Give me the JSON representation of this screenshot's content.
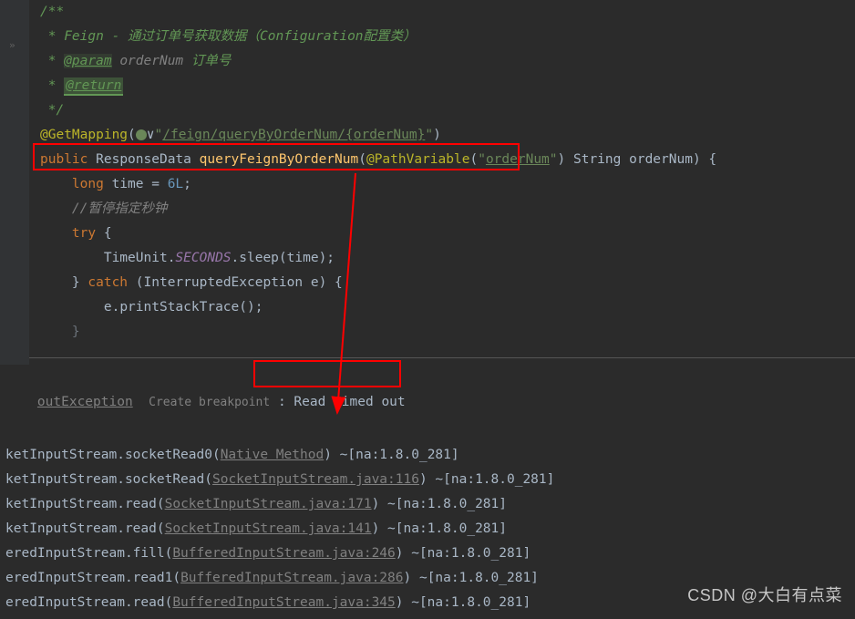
{
  "code": {
    "doc_line1": "/**",
    "doc_line2_prefix": " * ",
    "doc_line2_text": "Feign - 通过订单号获取数据（Configuration配置类）",
    "doc_line3_prefix": " * ",
    "doc_param_tag": "@param",
    "doc_param_name": " orderNum ",
    "doc_param_desc": "订单号",
    "doc_line4_prefix": " * ",
    "doc_return_tag": "@return",
    "doc_line5": " */",
    "annotation": "@GetMapping",
    "mapping_path": "/feign/queryByOrderNum/{orderNum}",
    "kw_public": "public",
    "return_type": "ResponseData",
    "method_name": "queryFeignByOrderNum",
    "path_var_anno": "@PathVariable",
    "path_var_value": "orderNum",
    "param_type": "String",
    "param_name": "orderNum",
    "kw_long": "long",
    "var_time": "time",
    "literal": "6L",
    "comment_pause": "//暂停指定秒钟",
    "kw_try": "try",
    "timeunit": "TimeUnit",
    "seconds": "SECONDS",
    "sleep": "sleep",
    "sleep_arg": "time",
    "kw_catch": "catch",
    "exception_type": "InterruptedException",
    "exception_var": "e",
    "print_stack": "printStackTrace"
  },
  "console": {
    "exception_text": "outException",
    "breakpoint_hint": "Create breakpoint",
    "error_message": "Read timed out",
    "stack": [
      {
        "prefix": "ketInputStream.socketRead0(",
        "link": "Native Method",
        "suffix": ") ~[na:1.8.0_281]"
      },
      {
        "prefix": "ketInputStream.socketRead(",
        "link": "SocketInputStream.java:116",
        "suffix": ") ~[na:1.8.0_281]"
      },
      {
        "prefix": "ketInputStream.read(",
        "link": "SocketInputStream.java:171",
        "suffix": ") ~[na:1.8.0_281]"
      },
      {
        "prefix": "ketInputStream.read(",
        "link": "SocketInputStream.java:141",
        "suffix": ") ~[na:1.8.0_281]"
      },
      {
        "prefix": "eredInputStream.fill(",
        "link": "BufferedInputStream.java:246",
        "suffix": ") ~[na:1.8.0_281]"
      },
      {
        "prefix": "eredInputStream.read1(",
        "link": "BufferedInputStream.java:286",
        "suffix": ") ~[na:1.8.0_281]"
      },
      {
        "prefix": "eredInputStream.read(",
        "link": "BufferedInputStream.java:345",
        "suffix": ") ~[na:1.8.0_281]"
      }
    ]
  },
  "watermark": "CSDN @大白有点菜"
}
